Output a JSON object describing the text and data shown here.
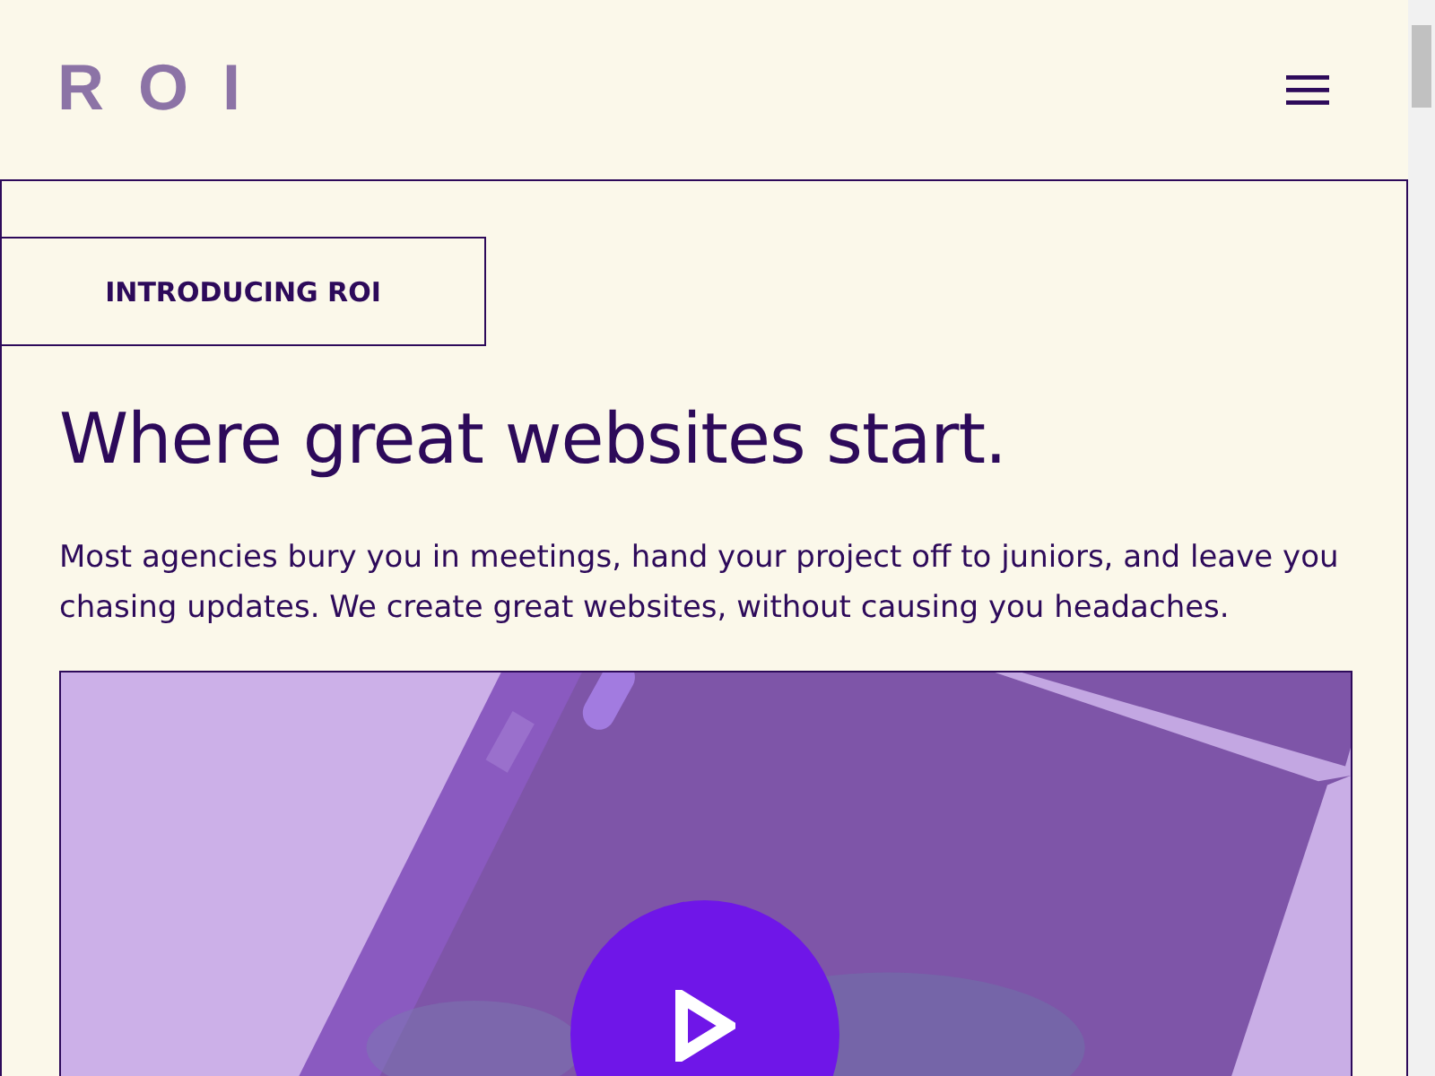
{
  "header": {
    "logo": "ROI"
  },
  "hero": {
    "badge": "INTRODUCING ROI",
    "title": "Where great websites start.",
    "text": "Most agencies bury you in meetings, hand your project off to juniors, and leave you chasing updates. We create great websites, without causing you headaches."
  }
}
